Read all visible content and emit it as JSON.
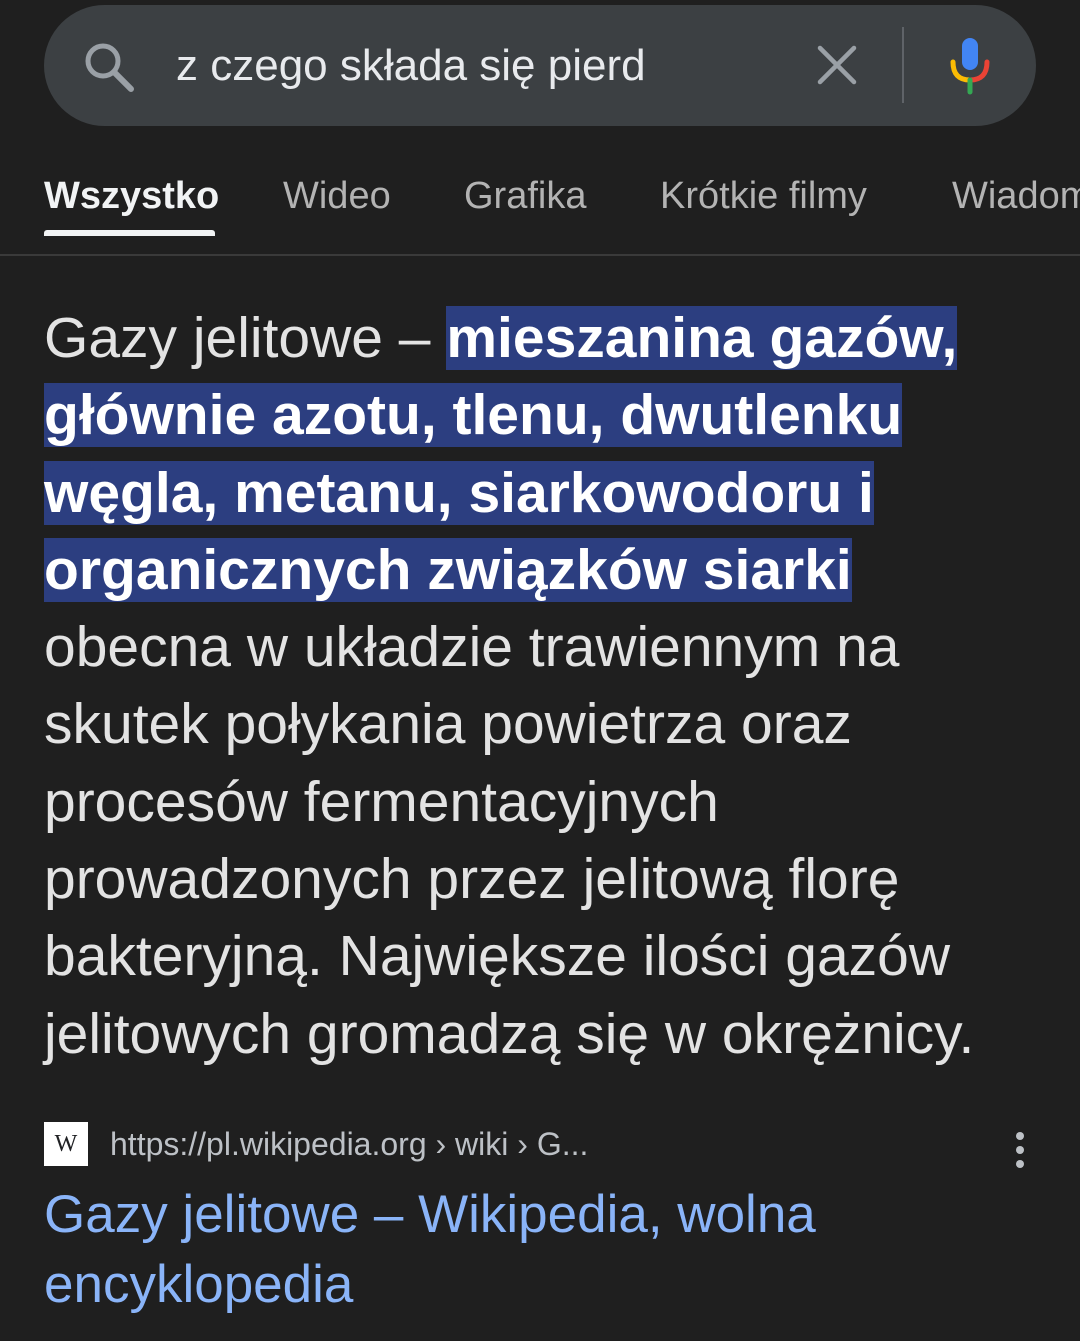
{
  "search": {
    "query": "z czego składa się pierd",
    "icons": {
      "search": "search-icon",
      "clear": "close-icon",
      "voice": "microphone-icon"
    }
  },
  "tabs": [
    {
      "label": "Wszystko",
      "active": true
    },
    {
      "label": "Wideo",
      "active": false
    },
    {
      "label": "Grafika",
      "active": false
    },
    {
      "label": "Krótkie filmy",
      "active": false
    },
    {
      "label": "Wiadomości",
      "active": false
    }
  ],
  "snippet": {
    "before": "Gazy jelitowe – ",
    "highlighted": "mieszanina gazów, głównie azotu, tlenu, dwutlenku węgla, metanu, siarkowodoru i organicznych związków siarki",
    "after": " obecna w układzie trawiennym na skutek połykania powietrza oraz procesów fermentacyjnych prowadzonych przez jelitową florę bakteryjną. Największe ilości gazów jelitowych gromadzą się w okrężnicy."
  },
  "result": {
    "favicon_letter": "W",
    "url": "https://pl.wikipedia.org › wiki › G...",
    "title": "Gazy jelitowe – Wikipedia, wolna encyklopedia"
  },
  "colors": {
    "background": "#1f1f1f",
    "search_bar": "#3c4043",
    "highlight_bg": "#2c3e80",
    "link": "#8ab4f8",
    "google_blue": "#4285f4",
    "google_red": "#ea4335",
    "google_yellow": "#fbbc04",
    "google_green": "#34a853"
  }
}
